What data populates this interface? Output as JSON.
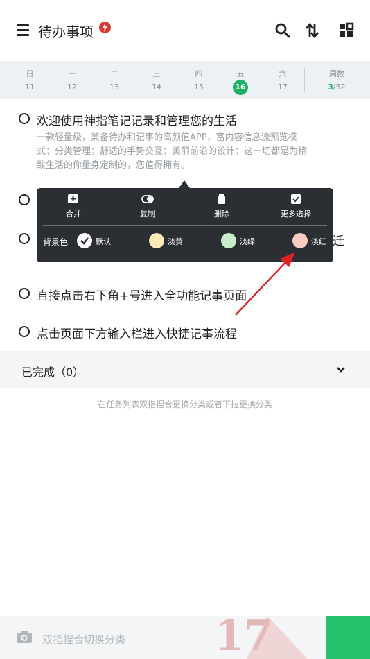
{
  "header": {
    "title": "待办事项",
    "icons": [
      "menu-icon",
      "fire-icon",
      "search-icon",
      "sort-icon",
      "grid-icon"
    ]
  },
  "calendar": {
    "days": [
      {
        "weekday": "日",
        "date": "11",
        "today": false
      },
      {
        "weekday": "一",
        "date": "12",
        "today": false
      },
      {
        "weekday": "二",
        "date": "13",
        "today": false
      },
      {
        "weekday": "三",
        "date": "14",
        "today": false
      },
      {
        "weekday": "四",
        "date": "15",
        "today": false
      },
      {
        "weekday": "五",
        "date": "16",
        "today": true
      },
      {
        "weekday": "六",
        "date": "17",
        "today": false
      }
    ],
    "week_label": "周数",
    "week_done": "3",
    "week_total": "/52",
    "accent": "#1ab167"
  },
  "tasks": [
    {
      "text": "欢迎使用神指笔记记录和管理您的生活",
      "desc_lines": [
        "一款轻量级，兼备待办和记事的高颜值APP，富内容信息流预览模",
        "式；分类管理；舒适的手势交互；美丽前沿的设计；这一切都是为精",
        "致生活的你量身定制的，您值得拥有。"
      ]
    },
    {
      "text": ""
    },
    {
      "text": "迁"
    },
    {
      "text": "直接点击右下角+号进入全功能记事页面"
    },
    {
      "text": "点击页面下方输入栏进入快捷记事流程"
    }
  ],
  "popup": {
    "actions": [
      {
        "label": "合并",
        "icon": "merge-icon"
      },
      {
        "label": "复制",
        "icon": "copy-icon"
      },
      {
        "label": "删除",
        "icon": "trash-icon"
      },
      {
        "label": "更多选择",
        "icon": "checkbox-icon"
      }
    ],
    "bg_label": "背景色",
    "swatches": [
      {
        "label": "默认",
        "color": "#ffffff",
        "selected": true
      },
      {
        "label": "淡黄",
        "color": "#fde9b3",
        "selected": false
      },
      {
        "label": "淡绿",
        "color": "#c6efc9",
        "selected": false
      },
      {
        "label": "淡红",
        "color": "#f8cdbf",
        "selected": false
      }
    ]
  },
  "completed": {
    "label": "已完成（0）"
  },
  "hint": "在任务列表双指捏合更换分类或者下拉更换分类",
  "bottom": {
    "placeholder": "双指捏合切换分类",
    "watermark": "17"
  }
}
